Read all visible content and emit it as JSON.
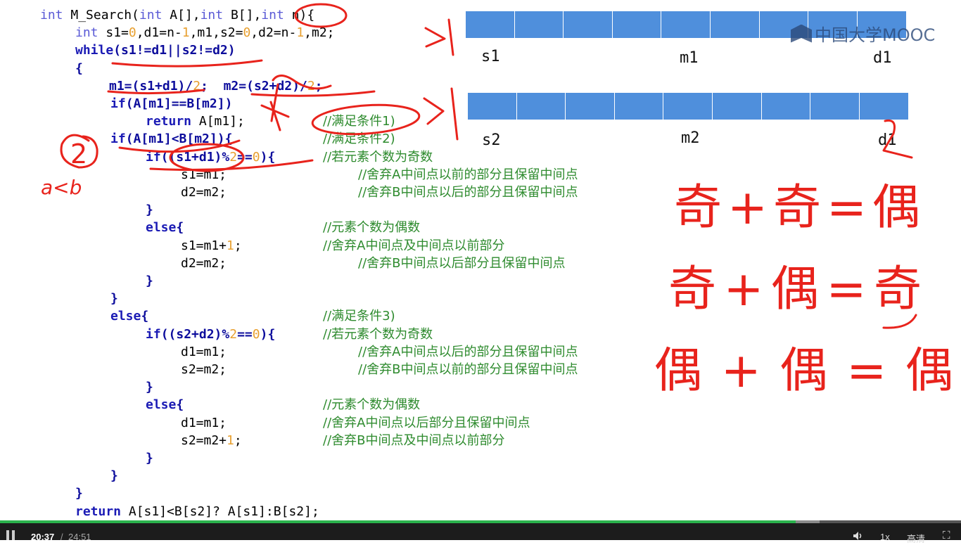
{
  "code": {
    "lines": [
      {
        "tokens": [
          [
            "t",
            "int"
          ],
          [
            "p",
            " M_Search("
          ],
          [
            "t",
            "int"
          ],
          [
            "p",
            " A[],"
          ],
          [
            "t",
            "int"
          ],
          [
            "p",
            " B[],"
          ],
          [
            "t",
            "int"
          ],
          [
            "p",
            " n){"
          ]
        ]
      },
      {
        "tokens": [
          [
            "t",
            "int"
          ],
          [
            "p",
            " s1="
          ],
          [
            "n",
            "0"
          ],
          [
            "p",
            ",d1=n-"
          ],
          [
            "n",
            "1"
          ],
          [
            "p",
            ",m1,s2="
          ],
          [
            "n",
            "0"
          ],
          [
            "p",
            ",d2=n-"
          ],
          [
            "n",
            "1"
          ],
          [
            "p",
            ",m2;"
          ]
        ]
      },
      {
        "tokens": [
          [
            "k",
            "while"
          ],
          [
            "o",
            "(s1!=d1||s2!=d2)"
          ]
        ]
      },
      {
        "tokens": [
          [
            "o",
            "{"
          ]
        ]
      },
      {
        "tokens": [
          [
            "o",
            "m1=(s1+d1)/"
          ],
          [
            "n",
            "2"
          ],
          [
            "o",
            ";"
          ],
          [
            "p",
            "  "
          ],
          [
            "o",
            "m2=(s2+d2)/"
          ],
          [
            "n",
            "2"
          ],
          [
            "o",
            ";"
          ]
        ]
      },
      {
        "tokens": [
          [
            "k",
            "if"
          ],
          [
            "o",
            "(A[m1]==B[m2])"
          ]
        ]
      },
      {
        "tokens": [
          [
            "k",
            "return"
          ],
          [
            "p",
            " A[m1];"
          ]
        ]
      },
      {
        "tokens": [
          [
            "k",
            "if"
          ],
          [
            "o",
            "(A[m1]<B[m2]){"
          ]
        ]
      },
      {
        "tokens": [
          [
            "k",
            "if"
          ],
          [
            "o",
            "((s1+d1)%"
          ],
          [
            "n",
            "2"
          ],
          [
            "o",
            "=="
          ],
          [
            "n",
            "0"
          ],
          [
            "o",
            "){"
          ]
        ]
      },
      {
        "tokens": [
          [
            "p",
            "s1=m1;"
          ]
        ]
      },
      {
        "tokens": [
          [
            "p",
            "d2=m2;"
          ]
        ]
      },
      {
        "tokens": [
          [
            "o",
            "}"
          ]
        ]
      },
      {
        "tokens": [
          [
            "k",
            "else"
          ],
          [
            "o",
            "{"
          ]
        ]
      },
      {
        "tokens": [
          [
            "p",
            "s1=m1+"
          ],
          [
            "n",
            "1"
          ],
          [
            "p",
            ";"
          ]
        ]
      },
      {
        "tokens": [
          [
            "p",
            "d2=m2;"
          ]
        ]
      },
      {
        "tokens": [
          [
            "o",
            "}"
          ]
        ]
      },
      {
        "tokens": [
          [
            "o",
            "}"
          ]
        ]
      },
      {
        "tokens": [
          [
            "k",
            "else"
          ],
          [
            "o",
            "{"
          ]
        ]
      },
      {
        "tokens": [
          [
            "k",
            "if"
          ],
          [
            "o",
            "((s2+d2)%"
          ],
          [
            "n",
            "2"
          ],
          [
            "o",
            "=="
          ],
          [
            "n",
            "0"
          ],
          [
            "o",
            "){"
          ]
        ]
      },
      {
        "tokens": [
          [
            "p",
            "d1=m1;"
          ]
        ]
      },
      {
        "tokens": [
          [
            "p",
            "s2=m2;"
          ]
        ]
      },
      {
        "tokens": [
          [
            "o",
            "}"
          ]
        ]
      },
      {
        "tokens": [
          [
            "k",
            "else"
          ],
          [
            "o",
            "{"
          ]
        ]
      },
      {
        "tokens": [
          [
            "p",
            "d1=m1;"
          ]
        ]
      },
      {
        "tokens": [
          [
            "p",
            "s2=m2+"
          ],
          [
            "n",
            "1"
          ],
          [
            "p",
            ";"
          ]
        ]
      },
      {
        "tokens": [
          [
            "o",
            "}"
          ]
        ]
      },
      {
        "tokens": [
          [
            "o",
            "}"
          ]
        ]
      },
      {
        "tokens": [
          [
            "o",
            "}"
          ]
        ]
      },
      {
        "tokens": [
          [
            "k",
            "return"
          ],
          [
            "p",
            " A[s1]<B[s2]? A[s1]:B[s2];"
          ]
        ]
      }
    ],
    "comments": [
      "//满足条件1)",
      "//满足条件2)",
      "//若元素个数为奇数",
      "//舍弃A中间点以前的部分且保留中间点",
      "//舍弃B中间点以后的部分且保留中间点",
      "//元素个数为偶数",
      "//舍弃A中间点及中间点以前部分",
      "//舍弃B中间点以后部分且保留中间点",
      "//满足条件3)",
      "//若元素个数为奇数",
      "//舍弃A中间点以后的部分且保留中间点",
      "//舍弃B中间点以前的部分且保留中间点",
      "//元素个数为偶数",
      "//舍弃A中间点以后部分且保留中间点",
      "//舍弃B中间点及中间点以前部分"
    ]
  },
  "arrays": {
    "A": {
      "cells": 9,
      "labels": [
        "s1",
        "m1",
        "d1"
      ]
    },
    "B": {
      "cells": 9,
      "labels": [
        "s2",
        "m2",
        "d1"
      ]
    }
  },
  "watermark": {
    "text": "中国大学MOOC"
  },
  "handwriting": {
    "circled_number": "2",
    "condition": "a<b",
    "mark_two": "2",
    "rule1": "奇+奇=偶",
    "rule2": "奇+偶=奇",
    "rule3": "偶+偶=偶"
  },
  "player": {
    "current_time": "20:37",
    "separator": "/",
    "total_time": "24:51",
    "progress": 0.828,
    "buffered": 0.853,
    "speed": "1x",
    "quality": "高清",
    "volume_icon": "volume-icon",
    "fullscreen_icon": "fullscreen-icon",
    "pause_icon": "pause-icon"
  },
  "colors": {
    "keyword": "#1b1bb5",
    "type": "#5a5ad6",
    "number": "#e8a030",
    "comment": "#2e8b2e",
    "array_cell": "#4f8fdc",
    "ink": "#e8231c",
    "progress": "#2bb24c"
  }
}
